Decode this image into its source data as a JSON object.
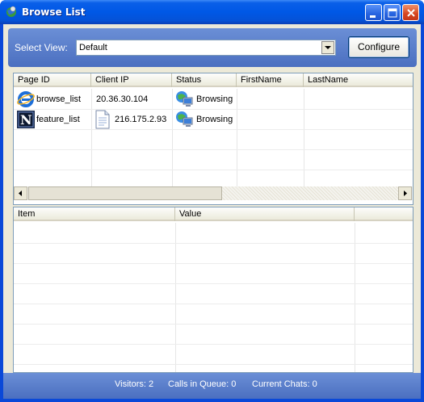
{
  "window": {
    "title": "Browse List"
  },
  "toolbar": {
    "select_view_label": "Select View:",
    "select_view_value": "Default",
    "configure_label": "Configure"
  },
  "visitors_table": {
    "columns": [
      "Page ID",
      "Client IP",
      "Status",
      "FirstName",
      "LastName"
    ],
    "rows": [
      {
        "page_id": "browse_list",
        "client_ip": "20.36.30.104",
        "status": "Browsing",
        "first_name": "",
        "last_name": "",
        "browser_icon": "internet-explorer-icon",
        "status_icon": "network-computer-icon"
      },
      {
        "page_id": "feature_list",
        "client_ip": "216.175.2.93",
        "status": "Browsing",
        "first_name": "",
        "last_name": "",
        "browser_icon": "netscape-icon",
        "client_icon": "document-icon",
        "status_icon": "network-computer-icon"
      }
    ]
  },
  "details_table": {
    "columns": [
      "Item",
      "Value"
    ]
  },
  "statusbar": {
    "visitors": "Visitors: 2",
    "calls_in_queue": "Calls in Queue: 0",
    "current_chats": "Current Chats: 0"
  },
  "colors": {
    "titlebar": "#0058e6",
    "toolbar": "#5b7fcb",
    "client_bg": "#ece9d8"
  }
}
